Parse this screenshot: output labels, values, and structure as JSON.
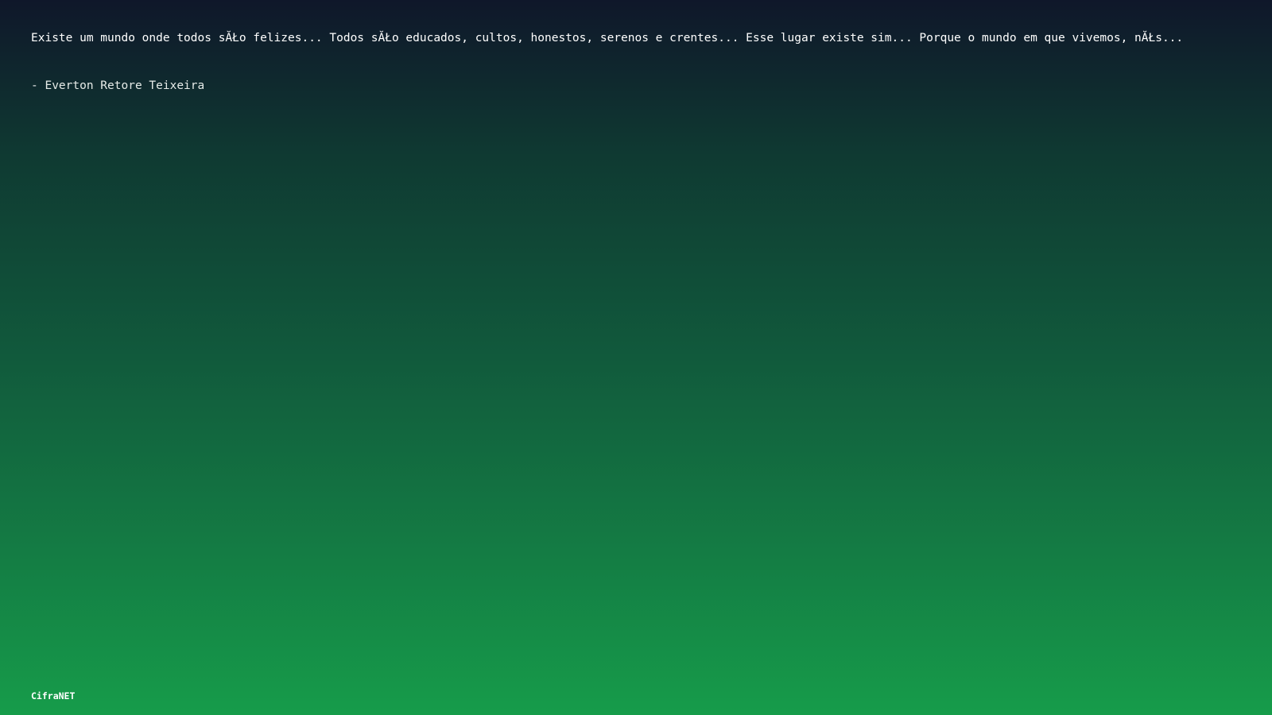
{
  "quote": {
    "text": "Existe um mundo onde todos sĂŁo felizes... Todos sĂŁo educados, cultos, honestos, serenos e crentes... Esse lugar existe sim... Porque o mundo em que vivemos, nĂŁs...",
    "author": "- Everton Retore Teixeira"
  },
  "footer": {
    "brand": "CifraNET"
  },
  "colors": {
    "gradient_top": "#0f172a",
    "gradient_bottom": "#169c4a",
    "text": "#ffffff"
  }
}
